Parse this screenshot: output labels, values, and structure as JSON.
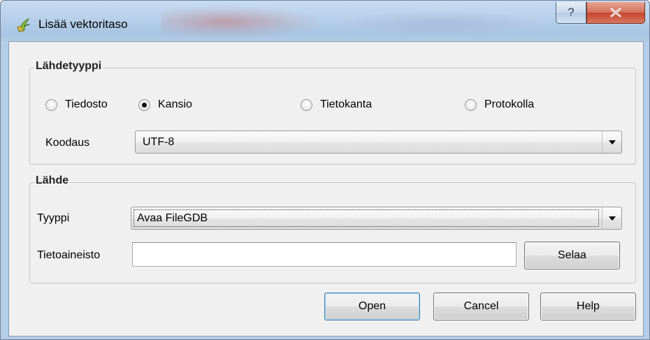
{
  "window": {
    "title": "Lisää vektoritaso",
    "help_glyph": "?",
    "close_glyph": "X"
  },
  "source_type": {
    "group_title": "Lähdetyyppi",
    "options": [
      {
        "label": "Tiedosto",
        "checked": false
      },
      {
        "label": "Kansio",
        "checked": true
      },
      {
        "label": "Tietokanta",
        "checked": false
      },
      {
        "label": "Protokolla",
        "checked": false
      }
    ],
    "encoding_label": "Koodaus",
    "encoding_value": "UTF-8"
  },
  "source": {
    "group_title": "Lähde",
    "type_label": "Tyyppi",
    "type_value": "Avaa FileGDB",
    "dataset_label": "Tietoaineisto",
    "dataset_value": "",
    "browse_label": "Selaa"
  },
  "buttons": {
    "open": "Open",
    "cancel": "Cancel",
    "help": "Help"
  },
  "icons": {
    "app": "qgis-icon",
    "dropdown": "chevron-down-icon",
    "close": "close-icon",
    "help": "help-icon"
  },
  "colors": {
    "client_bg": "#f0f0f0",
    "close_button": "#c4452d",
    "title_bar": "#b9d1ea"
  }
}
